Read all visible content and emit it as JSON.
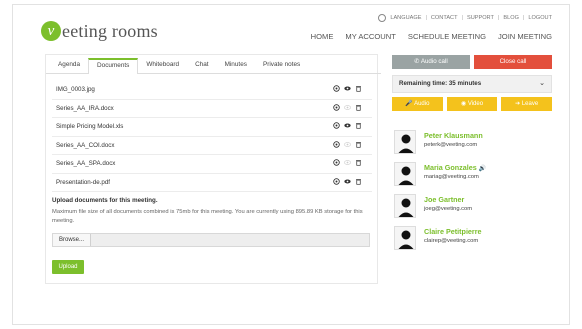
{
  "logo": {
    "initial": "v",
    "text": "eeting rooms"
  },
  "topbar": {
    "links": [
      "LANGUAGE",
      "CONTACT",
      "SUPPORT",
      "BLOG",
      "LOGOUT"
    ]
  },
  "nav": [
    "HOME",
    "MY ACCOUNT",
    "SCHEDULE MEETING",
    "JOIN MEETING"
  ],
  "tabs": [
    "Agenda",
    "Documents",
    "Whiteboard",
    "Chat",
    "Minutes",
    "Private notes"
  ],
  "active_tab": "Documents",
  "documents": [
    {
      "name": "IMG_0003.jpg",
      "viewable": true
    },
    {
      "name": "Series_AA_IRA.docx",
      "viewable": false
    },
    {
      "name": "Simple Pricing Model.xls",
      "viewable": true
    },
    {
      "name": "Series_AA_COI.docx",
      "viewable": false
    },
    {
      "name": "Series_AA_SPA.docx",
      "viewable": false
    },
    {
      "name": "Presentation-de.pdf",
      "viewable": true
    }
  ],
  "upload": {
    "title": "Upload documents for this meeting.",
    "info": "Maximum file size of all documents combined is 75mb for this meeting. You are currently using 895.89 KB storage for this meeting.",
    "browse_label": "Browse...",
    "button_label": "Upload"
  },
  "call": {
    "audio_label": "Audio call",
    "close_label": "Close call"
  },
  "remaining_time": "Remaining time: 35 minutes",
  "actions": [
    "Audio",
    "Video",
    "Leave"
  ],
  "participants": [
    {
      "name": "Peter Klausmann",
      "email": "peterk@veeting.com",
      "speaking": false
    },
    {
      "name": "Maria Gonzales",
      "email": "mariag@veeting.com",
      "speaking": true
    },
    {
      "name": "Joe Gartner",
      "email": "joeg@veeting.com",
      "speaking": false
    },
    {
      "name": "Claire Petitpierre",
      "email": "clairep@veeting.com",
      "speaking": false
    }
  ],
  "colors": {
    "brand_green": "#7cbf2c",
    "close_red": "#e34f3c",
    "action_yellow": "#f4c21c",
    "audio_gray": "#9aa3a3"
  }
}
